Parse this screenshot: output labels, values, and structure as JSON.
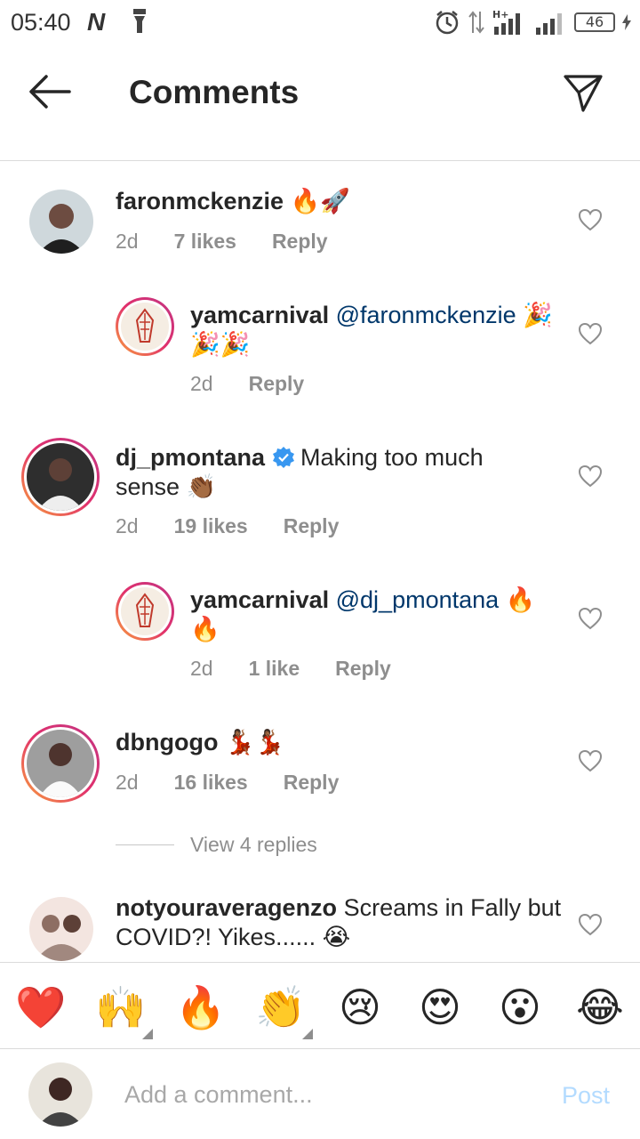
{
  "status_bar": {
    "time": "05:40",
    "network_letter": "N",
    "battery": "46",
    "network_type": "H+"
  },
  "header": {
    "title": "Comments"
  },
  "comments": [
    {
      "username": "faronmckenzie",
      "text": "🔥🚀",
      "time": "2d",
      "likes": "7 likes",
      "reply": "Reply"
    },
    {
      "username": "yamcarnival",
      "mention": "@faronmckenzie",
      "text": "🎉🎉🎉",
      "time": "2d",
      "reply": "Reply"
    },
    {
      "username": "dj_pmontana",
      "text": "Making too much sense 👏🏾",
      "time": "2d",
      "likes": "19 likes",
      "reply": "Reply",
      "verified": true
    },
    {
      "username": "yamcarnival",
      "mention": "@dj_pmontana",
      "text": "🔥🔥",
      "time": "2d",
      "likes": "1 like",
      "reply": "Reply"
    },
    {
      "username": "dbngogo",
      "text": "💃🏾💃🏾",
      "time": "2d",
      "likes": "16 likes",
      "reply": "Reply"
    },
    {
      "username": "notyouraveragenzo",
      "text": "Screams in Fally but COVID?! Yikes...... 😭"
    }
  ],
  "view_replies": "View 4 replies",
  "emoji_bar": [
    "❤️",
    "🙌",
    "🔥",
    "👏",
    "😢",
    "😍",
    "😮",
    "😂"
  ],
  "composer": {
    "placeholder": "Add a comment...",
    "post_label": "Post"
  },
  "colors": {
    "text": "#262626",
    "secondary": "#8e8e8e",
    "mention": "#00376b",
    "post_disabled": "#b3dbff"
  }
}
